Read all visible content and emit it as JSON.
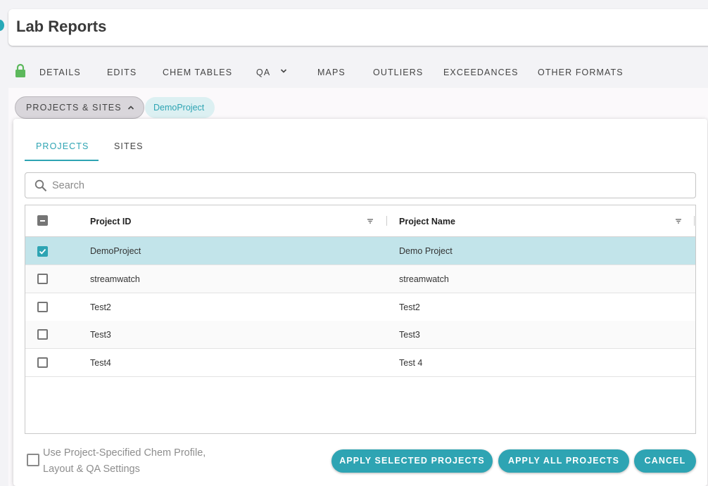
{
  "app": {
    "title": "Lab Reports"
  },
  "nav": {
    "lock": "lock-icon",
    "items": [
      "DETAILS",
      "EDITS",
      "CHEM TABLES",
      "QA",
      "MAPS",
      "OUTLIERS",
      "EXCEEDANCES",
      "OTHER FORMATS"
    ]
  },
  "chips": {
    "projects_sites": "PROJECTS & SITES",
    "selected": "DemoProject"
  },
  "panel": {
    "tabs": [
      "PROJECTS",
      "SITES"
    ],
    "active_tab": "PROJECTS",
    "search": {
      "placeholder": "Search",
      "value": ""
    },
    "columns": [
      "Project ID",
      "Project Name"
    ],
    "rows": [
      {
        "id": "DemoProject",
        "name": "Demo Project",
        "checked": true
      },
      {
        "id": "streamwatch",
        "name": "streamwatch",
        "checked": false
      },
      {
        "id": "Test2",
        "name": "Test2",
        "checked": false
      },
      {
        "id": "Test3",
        "name": "Test3",
        "checked": false
      },
      {
        "id": "Test4",
        "name": "Test 4",
        "checked": false
      }
    ],
    "option_label_line1": "Use Project-Specified Chem Profile,",
    "option_label_line2": "Layout & QA Settings",
    "buttons": {
      "apply_selected": "APPLY SELECTED PROJECTS",
      "apply_all": "APPLY ALL PROJECTS",
      "cancel": "CANCEL"
    }
  },
  "colors": {
    "accent": "#2ea4b3",
    "selected_row": "#c2e4ea",
    "lock": "#5cb85c"
  }
}
